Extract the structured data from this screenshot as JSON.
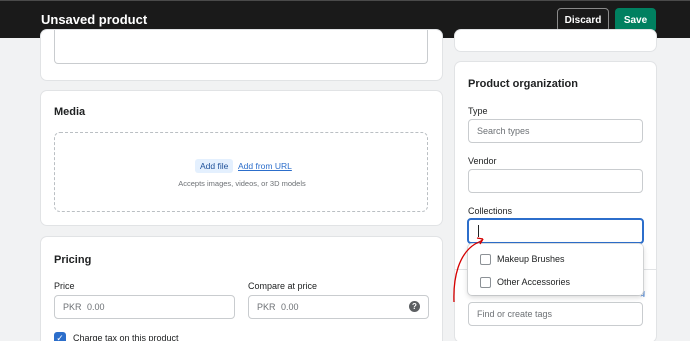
{
  "topbar": {
    "title": "Unsaved product",
    "discard_label": "Discard",
    "save_label": "Save"
  },
  "media": {
    "title": "Media",
    "add_file_label": "Add file",
    "add_url_label": "Add from URL",
    "accepts_text": "Accepts images, videos, or 3D models"
  },
  "pricing": {
    "title": "Pricing",
    "price_label": "Price",
    "price_currency": "PKR",
    "price_placeholder": "0.00",
    "compare_label": "Compare at price",
    "compare_currency": "PKR",
    "compare_placeholder": "0.00",
    "charge_tax_label": "Charge tax on this product"
  },
  "organization": {
    "title": "Product organization",
    "type_label": "Type",
    "type_placeholder": "Search types",
    "vendor_label": "Vendor",
    "collections_label": "Collections",
    "collections_options": [
      "Makeup Brushes",
      "Other Accessories"
    ],
    "tags_placeholder": "Find or create tags"
  },
  "colors": {
    "topbar_bg": "#1a1a1a",
    "save_green": "#008060",
    "focus_blue": "#2c6ecb",
    "annotation_red": "#d50000"
  }
}
